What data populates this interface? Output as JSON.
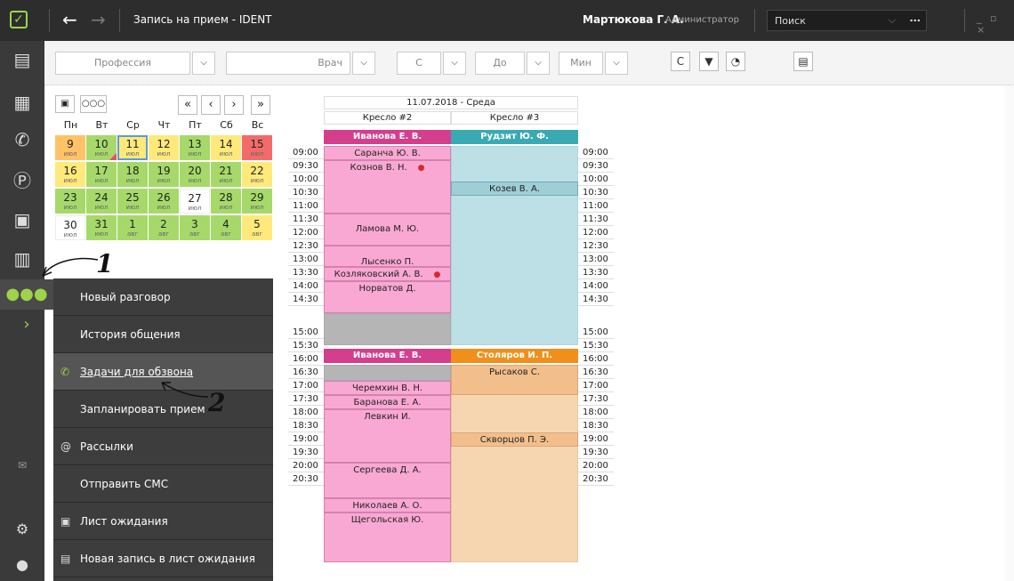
{
  "titlebar": {
    "window_title": "Запись на прием - IDENT",
    "user_name": "Мартюкова Г. А.",
    "user_role": "Администратор",
    "search_placeholder": "Поиск",
    "search_more": "..."
  },
  "toolbar": {
    "profession": "Профессия",
    "doctor": "Врач",
    "from": "С",
    "to": "До",
    "min": "Мин"
  },
  "calendar": {
    "weekdays": [
      "Пн",
      "Вт",
      "Ср",
      "Чт",
      "Пт",
      "Сб",
      "Вс"
    ],
    "rows": [
      [
        {
          "d": "9",
          "m": "июл"
        },
        {
          "d": "10",
          "m": "июл"
        },
        {
          "d": "11",
          "m": "июл"
        },
        {
          "d": "12",
          "m": "июл"
        },
        {
          "d": "13",
          "m": "июл"
        },
        {
          "d": "14",
          "m": "июл"
        },
        {
          "d": "15",
          "m": "июл"
        }
      ],
      [
        {
          "d": "16",
          "m": "июл"
        },
        {
          "d": "17",
          "m": "июл"
        },
        {
          "d": "18",
          "m": "июл"
        },
        {
          "d": "19",
          "m": "июл"
        },
        {
          "d": "20",
          "m": "июл"
        },
        {
          "d": "21",
          "m": "июл"
        },
        {
          "d": "22",
          "m": "июл"
        }
      ],
      [
        {
          "d": "23",
          "m": "июл"
        },
        {
          "d": "24",
          "m": "июл"
        },
        {
          "d": "25",
          "m": "июл"
        },
        {
          "d": "26",
          "m": "июл"
        },
        {
          "d": "27",
          "m": "июл"
        },
        {
          "d": "28",
          "m": "июл"
        },
        {
          "d": "29",
          "m": "июл"
        }
      ],
      [
        {
          "d": "30",
          "m": "июл"
        },
        {
          "d": "31",
          "m": "июл"
        },
        {
          "d": "1",
          "m": "авг"
        },
        {
          "d": "2",
          "m": "авг"
        },
        {
          "d": "3",
          "m": "авг"
        },
        {
          "d": "4",
          "m": "авг"
        },
        {
          "d": "5",
          "m": "авг"
        }
      ]
    ]
  },
  "menu": {
    "items": [
      "Новый разговор",
      "История общения",
      "Задачи для обзвона",
      "Запланировать прием",
      "Рассылки",
      "Отправить СМС",
      "Лист ожидания",
      "Новая запись в лист ожидания"
    ]
  },
  "annotations": {
    "one": "1",
    "two": "2"
  },
  "schedule": {
    "date_header": "11.07.2018 - Среда",
    "chairs": [
      "Кресло #2",
      "Кресло #3"
    ],
    "times": [
      "09:00",
      "09:30",
      "10:00",
      "10:30",
      "11:00",
      "11:30",
      "12:00",
      "12:30",
      "13:00",
      "13:30",
      "14:00",
      "14:30",
      "",
      "15:00",
      "15:30",
      "16:00",
      "16:30",
      "17:00",
      "17:30",
      "18:00",
      "18:30",
      "19:00",
      "19:30",
      "20:00",
      "20:30"
    ],
    "doctors": {
      "c2_morning": "Иванова Е. В.",
      "c3_morning": "Рудзит Ю. Ф.",
      "c2_evening": "Иванова Е. В.",
      "c3_evening": "Столяров И. П."
    },
    "patients": {
      "p1": "Саранча Ю. В.",
      "p2": "Кознов В. Н.",
      "p3": "Козев В. А.",
      "p4": "Ламова М. Ю.",
      "p5": "Лысенко П.",
      "p6": "Козляковский А. В.",
      "p7": "Норватов Д.",
      "p8": "Рысаков С.",
      "p9": "Черемхин В. Н.",
      "p10": "Баранова Е. А.",
      "p11": "Левкин И.",
      "p12": "Скворцов П. Э.",
      "p13": "Сергеева Д. А.",
      "p14": "Николаев А. О.",
      "p15": "Щегольская Ю."
    }
  },
  "colors": {
    "accent": "#9ed34a",
    "doctor_pink": "#d43f8d",
    "doctor_teal": "#3aaab2",
    "doctor_orange": "#f0901a"
  }
}
